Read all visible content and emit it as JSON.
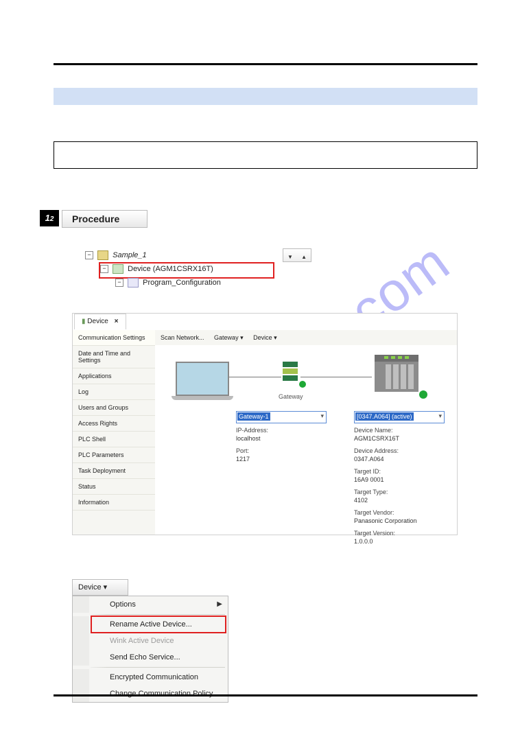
{
  "watermark": "manualshive.com",
  "step": {
    "num": "1",
    "sub": "2",
    "title": "Procedure"
  },
  "tree": {
    "root": "Sample_1",
    "device": "Device (AGM1CSRX16T)",
    "program": "Program_Configuration"
  },
  "deviceWindow": {
    "tabLabel": "Device",
    "toolbar": {
      "scan": "Scan Network...",
      "gateway": "Gateway ▾",
      "device": "Device ▾"
    },
    "side": [
      "Communication Settings",
      "Date and Time and Settings",
      "Applications",
      "Log",
      "Users and Groups",
      "Access Rights",
      "PLC Shell",
      "PLC Parameters",
      "Task Deployment",
      "Status",
      "Information"
    ],
    "gatewayLabel": "Gateway",
    "gatewayCombo": "Gateway-1",
    "deviceCombo": "[0347.A064] (active)",
    "gatewayInfo": {
      "ipLabel": "IP-Address:",
      "ip": "localhost",
      "portLabel": "Port:",
      "port": "1217"
    },
    "deviceInfo": {
      "nameLabel": "Device Name:",
      "name": "AGM1CSRX16T",
      "addrLabel": "Device Address:",
      "addr": "0347.A064",
      "tidLabel": "Target ID:",
      "tid": "16A9 0001",
      "ttypeLabel": "Target Type:",
      "ttype": "4102",
      "tvenLabel": "Target Vendor:",
      "tven": "Panasonic Corporation",
      "tverLabel": "Target Version:",
      "tver": "1.0.0.0"
    }
  },
  "menu": {
    "head": "Device ▾",
    "items": {
      "options": "Options",
      "rename": "Rename Active Device...",
      "wink": "Wink Active Device",
      "echo": "Send Echo Service...",
      "enc": "Encrypted Communication",
      "policy": "Change Communication Policy..."
    }
  }
}
